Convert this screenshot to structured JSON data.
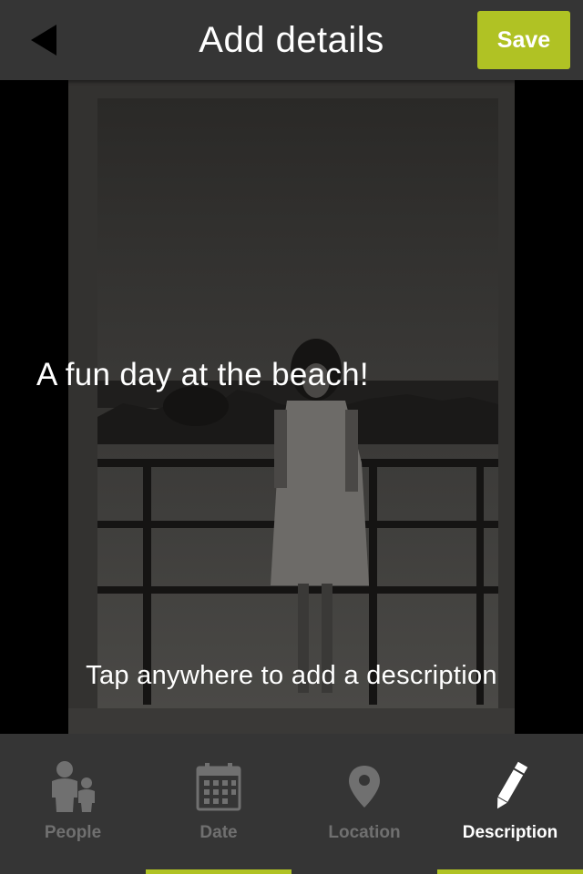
{
  "header": {
    "title": "Add details",
    "back_icon": "back-arrow-icon",
    "save_label": "Save"
  },
  "photo": {
    "description": "A fun day at the beach!",
    "hint": "Tap anywhere to add a description"
  },
  "tabs": [
    {
      "label": "People",
      "icon": "people-icon",
      "active": false,
      "underline": false
    },
    {
      "label": "Date",
      "icon": "calendar-icon",
      "active": false,
      "underline": true
    },
    {
      "label": "Location",
      "icon": "location-pin-icon",
      "active": false,
      "underline": false
    },
    {
      "label": "Description",
      "icon": "pencil-icon",
      "active": true,
      "underline": true
    }
  ],
  "colors": {
    "accent": "#b0c224",
    "bar_background": "#353535",
    "inactive_text": "#707070",
    "active_text": "#ffffff"
  }
}
